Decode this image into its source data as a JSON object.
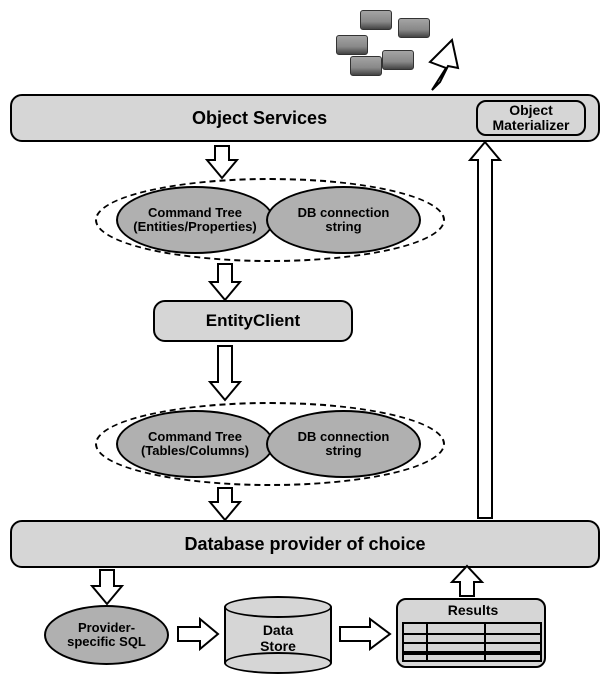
{
  "top_bar": {
    "title": "Object Services",
    "badge": "Object\nMaterializer"
  },
  "entity_client": {
    "label": "EntityClient"
  },
  "db_provider": {
    "label": "Database provider of choice"
  },
  "ovals": {
    "cmd_tree_entities": "Command Tree\n(Entities/Properties)",
    "db_conn_1": "DB connection\nstring",
    "cmd_tree_tables": "Command Tree\n(Tables/Columns)",
    "db_conn_2": "DB connection\nstring"
  },
  "provider_sql": {
    "label": "Provider-\nspecific SQL"
  },
  "data_store": {
    "label": "Data\nStore"
  },
  "results": {
    "label": "Results"
  }
}
